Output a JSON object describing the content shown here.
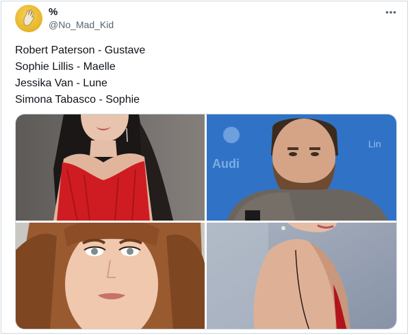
{
  "author": {
    "display_name": "%",
    "handle": "@No_Mad_Kid"
  },
  "tweet": {
    "lines": [
      "Robert Paterson - Gustave",
      "Sophie Lillis - Maelle",
      "Jessika Van - Lune",
      "Simona Tabasco - Sophie"
    ]
  },
  "icons": {
    "avatar": "hand-drawing-avatar",
    "more": "more-horizontal-icon"
  },
  "colors": {
    "text": "#0f1419",
    "secondary_text": "#536471",
    "border": "#cfd9de",
    "avatar_bg": "#e9b92e"
  }
}
